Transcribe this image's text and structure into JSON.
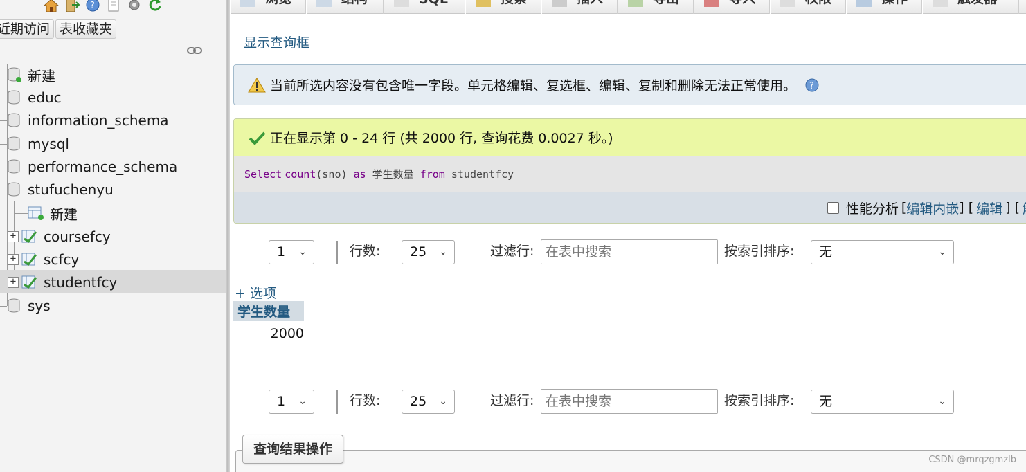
{
  "sidebar": {
    "buttons": {
      "recent": "近期访问",
      "favorites": "表收藏夹"
    },
    "top_icons": [
      "home-icon",
      "exit-icon",
      "help-icon",
      "docs-icon",
      "settings-icon",
      "reload-icon"
    ],
    "tree": {
      "new_root": "新建",
      "databases": [
        "educ",
        "information_schema",
        "mysql",
        "performance_schema",
        "stufuchenyu"
      ],
      "child_new": "新建",
      "tables": [
        "coursefcy",
        "scfcy",
        "studentfcy"
      ],
      "last_db": "sys"
    }
  },
  "tabs": [
    "浏览",
    "结构",
    "SQL",
    "搜索",
    "插入",
    "导出",
    "导入",
    "权限",
    "操作",
    "触发器"
  ],
  "main": {
    "show_query_box": "显示查询框",
    "warning": "当前所选内容没有包含唯一字段。单元格编辑、复选框、编辑、复制和删除无法正常使用。",
    "success": "正在显示第 0 - 24 行 (共 2000 行, 查询花费 0.0027 秒。)",
    "sql": {
      "select": "Select",
      "count": "count",
      "arg": "(sno)",
      "as": "as",
      "alias": "学生数量",
      "from": "from",
      "table": "studentfcy"
    },
    "profiling": {
      "label": "性能分析",
      "bracket_open": "[",
      "edit_inline": "编辑内嵌",
      "bracket_close": "]",
      "edit": "编辑",
      "explain_partial": "解"
    },
    "nav": {
      "page": "1",
      "rows_label": "行数:",
      "rows_value": "25",
      "filter_label": "过滤行:",
      "filter_placeholder": "在表中搜索",
      "sort_label": "按索引排序:",
      "sort_value": "无"
    },
    "options_link": "+ 选项",
    "result": {
      "column": "学生数量",
      "value": "2000"
    },
    "query_results_operations": "查询结果操作"
  },
  "watermark": "CSDN @mrqzgmzlb"
}
